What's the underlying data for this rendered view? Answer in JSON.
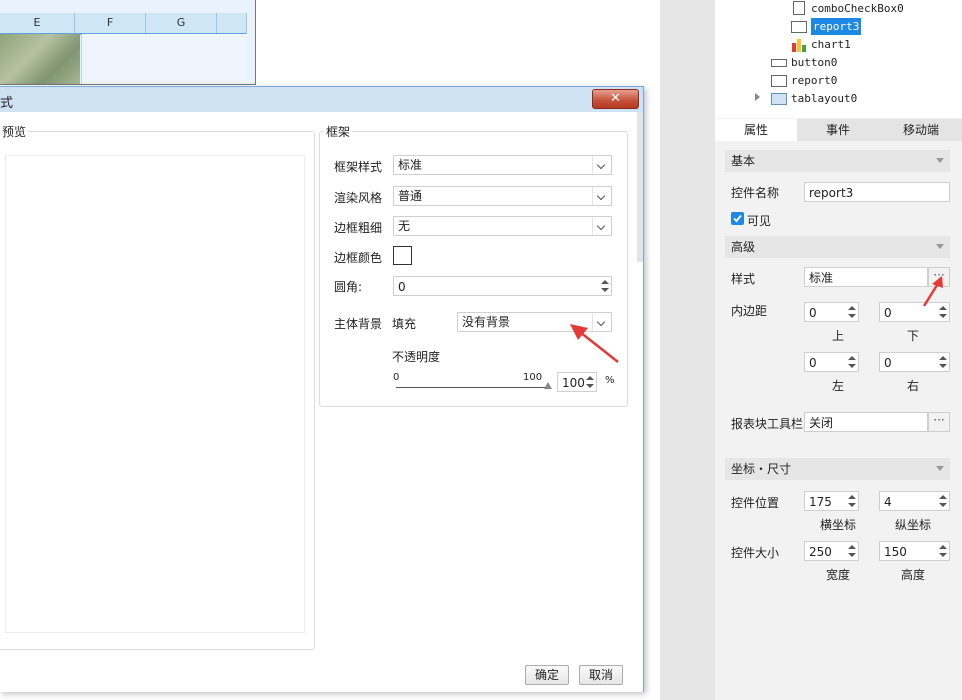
{
  "sheet": {
    "columns": [
      "E",
      "F",
      "G"
    ]
  },
  "tree": {
    "items": [
      {
        "label": "comboCheckBox0",
        "icon": "combo-check-box-icon"
      },
      {
        "label": "report3",
        "icon": "report-icon",
        "selected": true
      },
      {
        "label": "chart1",
        "icon": "chart-icon"
      },
      {
        "label": "button0",
        "icon": "button-icon"
      },
      {
        "label": "report0",
        "icon": "report-icon"
      },
      {
        "label": "tablayout0",
        "icon": "tablayout-icon"
      }
    ]
  },
  "tabs": [
    "属性",
    "事件",
    "移动端"
  ],
  "props": {
    "basic_title": "基本",
    "name_label": "控件名称",
    "name_value": "report3",
    "visible_label": "可见",
    "advanced_title": "高级",
    "style_label": "样式",
    "style_value": "标准",
    "padding_label": "内边距",
    "padding_top": "0",
    "padding_bottom": "0",
    "padding_left": "0",
    "padding_right": "0",
    "top_label": "上",
    "bottom_label": "下",
    "left_label": "左",
    "right_label": "右",
    "toolbar_label": "报表块工具栏",
    "toolbar_value": "关闭",
    "coord_title": "坐标・尺寸",
    "pos_label": "控件位置",
    "pos_x": "175",
    "pos_y": "4",
    "x_label": "横坐标",
    "y_label": "纵坐标",
    "size_label": "控件大小",
    "width": "250",
    "height": "150",
    "width_label": "宽度",
    "height_label": "高度",
    "ellipsis": "···"
  },
  "dialog": {
    "title": "式",
    "close": "✕",
    "preview_title": "预览",
    "frame_title": "框架",
    "frame_style_label": "框架样式",
    "frame_style_value": "标准",
    "render_label": "渲染风格",
    "render_value": "普通",
    "border_width_label": "边框粗细",
    "border_width_value": "无",
    "border_color_label": "边框颜色",
    "radius_label": "圆角:",
    "radius_value": "0",
    "bg_label": "主体背景",
    "fill_label": "填充",
    "fill_value": "没有背景",
    "opacity_label": "不透明度",
    "slider_min": "0",
    "slider_max": "100",
    "opacity_value": "100",
    "opacity_unit": "%",
    "opacity_level": 1.0,
    "ok": "确定",
    "cancel": "取消"
  },
  "colors": {
    "selection": "#1e88e5",
    "annotation_arrow": "#e53935",
    "dialog_title_bar": "#cfe2f4",
    "close_button": "#c75038"
  }
}
